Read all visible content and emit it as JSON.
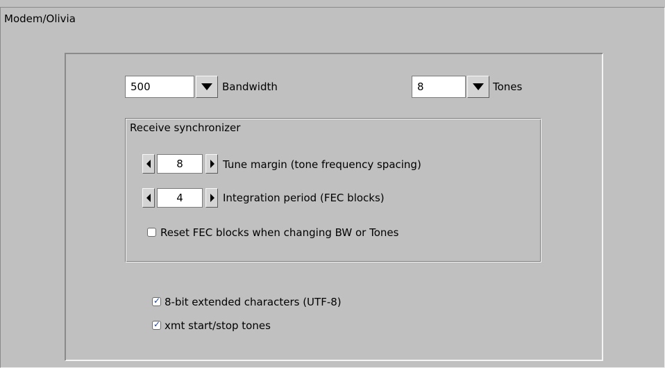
{
  "tab": {
    "title": "Modem/Olivia"
  },
  "bandwidth": {
    "value": "500",
    "label": "Bandwidth"
  },
  "tones": {
    "value": "8",
    "label": "Tones"
  },
  "receive_sync": {
    "title": "Receive synchronizer",
    "tune_margin": {
      "value": "8",
      "label": "Tune margin (tone frequency spacing)"
    },
    "integration_period": {
      "value": "4",
      "label": "Integration period (FEC blocks)"
    },
    "reset_fec": {
      "label": "Reset FEC blocks when changing BW or Tones",
      "checked": false
    }
  },
  "options": {
    "utf8": {
      "label": "8-bit extended characters (UTF-8)",
      "checked": true
    },
    "start_stop": {
      "label": "xmt start/stop tones",
      "checked": true
    }
  },
  "colors": {
    "background": "#c0c0c0",
    "checkmark": "#1a3fa0"
  },
  "icons": {
    "dropdown": "chevron-down-icon",
    "spin_left": "arrow-left-icon",
    "spin_right": "arrow-right-icon",
    "check": "check-icon"
  }
}
